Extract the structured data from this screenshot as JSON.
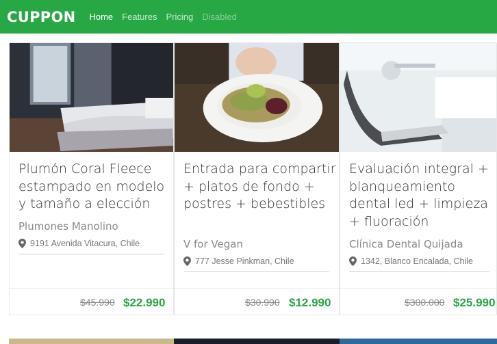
{
  "navbar": {
    "brand": "CUPPON",
    "links": [
      {
        "label": "Home"
      },
      {
        "label": "Features"
      },
      {
        "label": "Pricing"
      },
      {
        "label": "Disabled"
      }
    ]
  },
  "cards": [
    {
      "title": "Plumón Coral Fleece estampado en modelo y tamaño a elección",
      "merchant": "Plumones Manolino",
      "location": "9191 Avenida Vitacura, Chile",
      "old_price": "$45.990",
      "new_price": "$22.990",
      "image": "bedroom-bed-photo"
    },
    {
      "title": "Entrada para compartir + platos de fondo + postres + bebestibles",
      "merchant": "V for Vegan",
      "location": "777 Jesse Pinkman, Chile",
      "old_price": "$30.990",
      "new_price": "$12.990",
      "image": "vegan-salad-photo"
    },
    {
      "title": "Evaluación integral + blanqueamiento dental led + limpieza + fluoración",
      "merchant": "Clínica Dental Quijada",
      "location": "1342, Blanco Encalada, Chile",
      "old_price": "$300.000",
      "new_price": "$25.990",
      "image": "dental-chair-photo"
    }
  ],
  "colors": {
    "navbar": "#28a745",
    "price": "#28a745"
  },
  "icons": {
    "location": "map-marker-icon"
  }
}
